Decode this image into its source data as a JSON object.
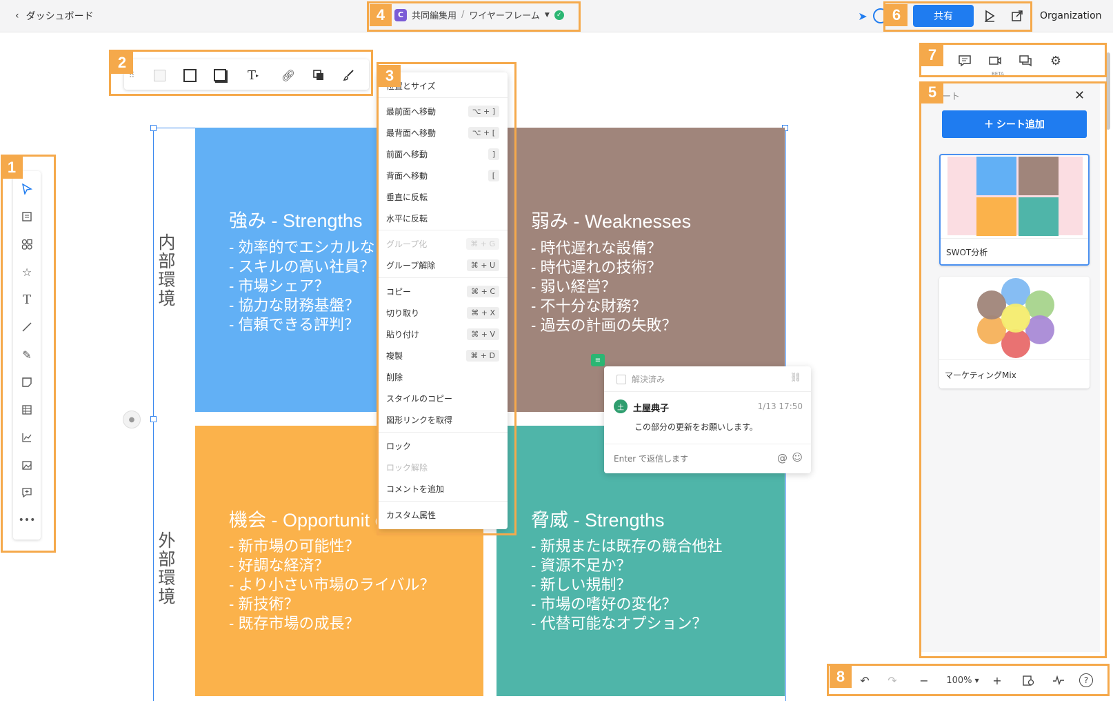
{
  "topbar": {
    "back_label": "ダッシュボード",
    "crumb_badge": "C",
    "crumb_folder": "共同編集用",
    "crumb_sep": "/",
    "crumb_file": "ワイヤーフレーム",
    "share_label": "共有",
    "org_label": "Organization"
  },
  "callouts": [
    "1",
    "2",
    "3",
    "4",
    "5",
    "6",
    "7",
    "8"
  ],
  "swot": {
    "internal_label": "内部環境",
    "external_label": "外部環境",
    "strengths": {
      "title": "強み - Strengths",
      "items": [
        "- 効率的でエシカルな",
        "- スキルの高い社員？",
        "- 市場シェア？",
        "- 協力な財務基盤？",
        "- 信頼できる評判？"
      ]
    },
    "weaknesses": {
      "title": "弱み - Weaknesses",
      "items": [
        "- 時代遅れな設備？",
        "- 時代遅れの技術？",
        "- 弱い経営？",
        "- 不十分な財務？",
        "- 過去の計画の失敗？"
      ]
    },
    "opportunities": {
      "title": "機会 - Opportunit e",
      "items": [
        "- 新市場の可能性？",
        "- 好調な経済？",
        "- より小さい市場のライバル？",
        "- 新技術？",
        "- 既存市場の成長？"
      ]
    },
    "threats": {
      "title": "脅威 - Strengths",
      "items": [
        "- 新規または既存の競合他社",
        "- 資源不足か？",
        "- 新しい規制？",
        "- 市場の嗜好の変化？",
        "- 代替可能なオプション？"
      ]
    }
  },
  "context_menu": {
    "header": "位置とサイズ",
    "items": [
      {
        "label": "最前面へ移動",
        "key": "⌥ + ]"
      },
      {
        "label": "最背面へ移動",
        "key": "⌥ + ["
      },
      {
        "label": "前面へ移動",
        "key": "]"
      },
      {
        "label": "背面へ移動",
        "key": "["
      },
      {
        "label": "垂直に反転",
        "key": ""
      },
      {
        "label": "水平に反転",
        "key": ""
      },
      {
        "label": "グループ化",
        "key": "⌘ + G"
      },
      {
        "label": "グループ解除",
        "key": "⌘ + U"
      },
      {
        "label": "コピー",
        "key": "⌘ + C"
      },
      {
        "label": "切り取り",
        "key": "⌘ + X"
      },
      {
        "label": "貼り付け",
        "key": "⌘ + V"
      },
      {
        "label": "複製",
        "key": "⌘ + D"
      },
      {
        "label": "削除",
        "key": ""
      },
      {
        "label": "スタイルのコピー",
        "key": ""
      },
      {
        "label": "図形リンクを取得",
        "key": ""
      },
      {
        "label": "ロック",
        "key": ""
      },
      {
        "label": "ロック解除",
        "key": ""
      },
      {
        "label": "コメントを追加",
        "key": ""
      },
      {
        "label": "カスタム属性",
        "key": ""
      }
    ]
  },
  "comment": {
    "resolved_label": "解決済み",
    "author": "土屋典子",
    "avatar_initial": "土",
    "timestamp": "1/13 17:50",
    "body": "この部分の更新をお願いします。",
    "reply_placeholder": "Enter で返信します"
  },
  "sheets_panel": {
    "title_partial": "ート",
    "add_label": "＋ シート追加",
    "sheets": [
      {
        "name": "SWOT分析"
      },
      {
        "name": "マーケティングMix"
      }
    ]
  },
  "rpanel_tab_beta": "BETA",
  "bottombar": {
    "zoom": "100%"
  },
  "colors": {
    "strengths": "#62b0f5",
    "weaknesses": "#a0857b",
    "opportunities": "#fbb24b",
    "threats": "#4fb5a9",
    "accent": "#1f7cf0",
    "callout": "#f5a94b"
  }
}
